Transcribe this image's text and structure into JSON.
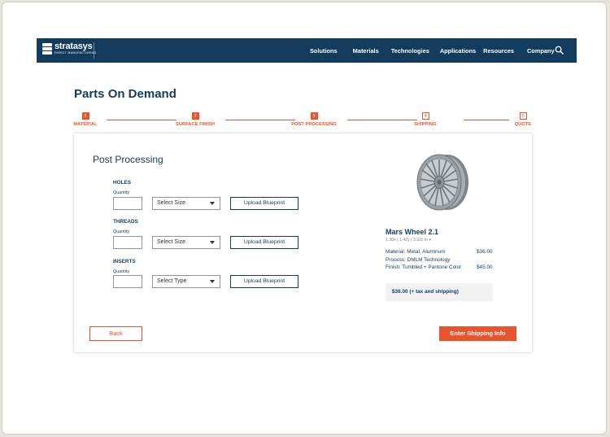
{
  "brand": {
    "name": "stratasys",
    "tagline": "DIRECT MANUFACTURING"
  },
  "nav": {
    "items": [
      "Solutions",
      "Materials",
      "Technologies",
      "Applications",
      "Resources",
      "Company"
    ],
    "search_icon": "search-icon"
  },
  "page": {
    "title": "Parts On Demand"
  },
  "stepper": {
    "steps": [
      {
        "num": "1",
        "label": "MATERIAL"
      },
      {
        "num": "2",
        "label": "SURFACE FINISH"
      },
      {
        "num": "3",
        "label": "POST PROCESSING"
      },
      {
        "num": "4",
        "label": "SHIPPING"
      },
      {
        "num": "5",
        "label": "QUOTE"
      }
    ],
    "completed_through": 3
  },
  "form": {
    "title": "Post Processing",
    "quantity_label": "Quantity",
    "upload_label": "Upload Blueprint",
    "sections": [
      {
        "label": "HOLES",
        "select": "Select Size",
        "quantity": ""
      },
      {
        "label": "THREADS",
        "select": "Select Size",
        "quantity": ""
      },
      {
        "label": "INSERTS",
        "select": "Select Type",
        "quantity": ""
      }
    ]
  },
  "product": {
    "name": "Mars Wheel 2.1",
    "dims": "1.30x | 1.42y | 3.92z in",
    "material": "Material: Metal, Aluminum",
    "material_price": "$36.00",
    "process": "Process: DMLM Technology",
    "finish": "Finish: Tumbled + Pantone Color",
    "finish_price": "$45.00",
    "total": "$36.00 (+ tax and shipping)"
  },
  "actions": {
    "back": "Back",
    "next": "Enter Shipping Info"
  },
  "colors": {
    "navy": "#123b5e",
    "accent": "#e8542c"
  }
}
